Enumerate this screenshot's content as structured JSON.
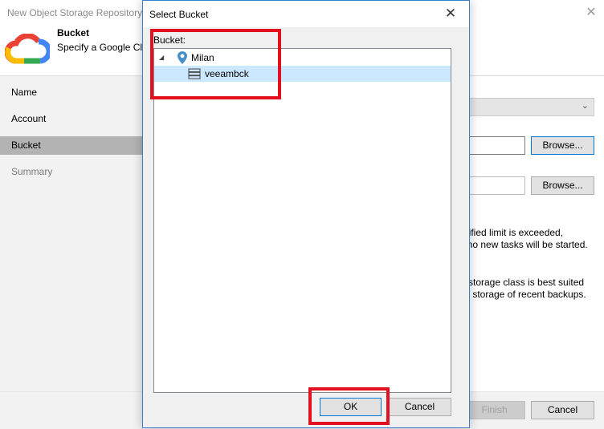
{
  "wizard": {
    "title": "New Object Storage Repository",
    "heading": "Bucket",
    "subheading": "Specify a Google Clo",
    "steps": [
      {
        "label": "Name"
      },
      {
        "label": "Account"
      },
      {
        "label": "Bucket"
      },
      {
        "label": "Summary"
      }
    ],
    "active_step": "Bucket",
    "browse_label": "Browse...",
    "info_line1a": "ecified limit is exceeded,",
    "info_line1b": "t no new tasks will be started.",
    "info_line2a": "is storage class is best suited",
    "info_line2b": "rm storage of recent backups.",
    "finish_label": "Finish",
    "cancel_label": "Cancel"
  },
  "dialog": {
    "title": "Select Bucket",
    "tree_label": "Bucket:",
    "tree": {
      "region": "Milan",
      "bucket": "veeambck",
      "selected": "veeambck"
    },
    "ok_label": "OK",
    "cancel_label": "Cancel"
  },
  "icons": {
    "wizard_logo": "google-cloud-icon",
    "region": "location-pin-icon",
    "bucket": "bucket-storage-icon",
    "expand": "tree-expanded-arrow-icon",
    "close": "close-icon"
  },
  "colors": {
    "highlight": "#e3101f",
    "selection": "#cce8ff",
    "sidebar_active": "#b3b3b3",
    "accent": "#0078d7"
  }
}
